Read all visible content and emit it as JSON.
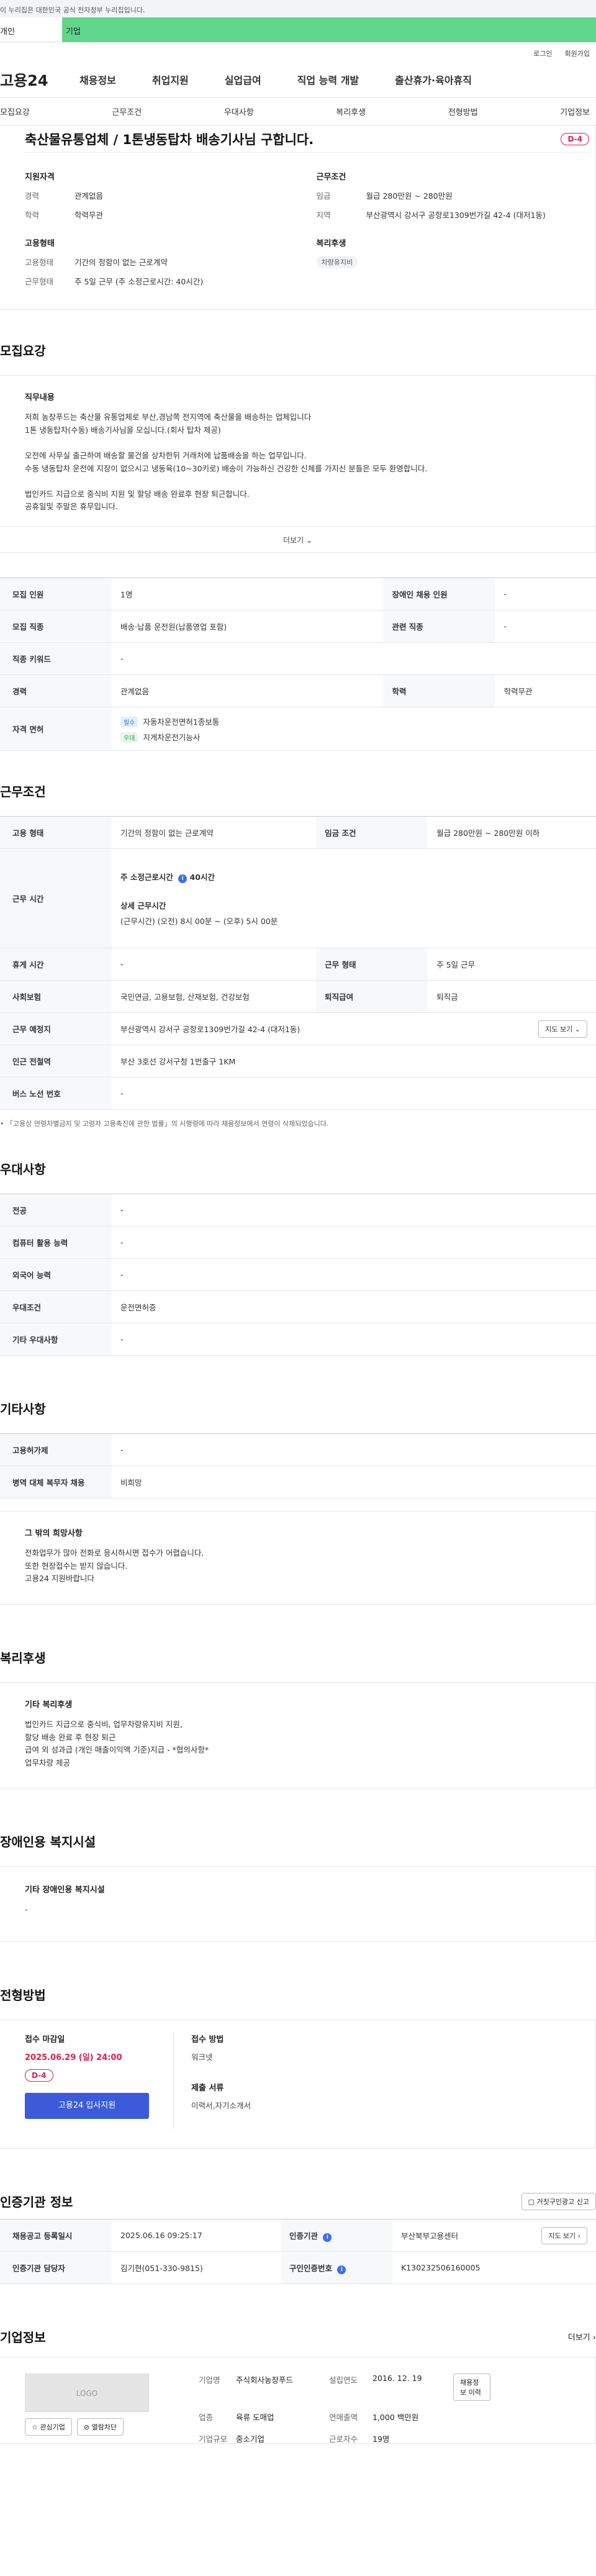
{
  "gov_notice": "이 누리집은 대한민국 공식 전자정부 누리집입니다.",
  "top_tabs": {
    "person": "개인",
    "company": "기업"
  },
  "util_links": [
    "로그인",
    "회원가입"
  ],
  "logo": "고용24",
  "gnb": [
    "채용정보",
    "취업지원",
    "실업급여",
    "직업 능력 개발",
    "출산휴가·육아휴직"
  ],
  "sub_tabs": [
    "모집요강",
    "근무조건",
    "우대사항",
    "복리후생",
    "전형방법",
    "기업정보"
  ],
  "summary": {
    "title": "축산물유통업체 / 1톤냉동탑차 배송기사님 구합니다.",
    "dday": "D-4",
    "qual": {
      "heading": "지원자격",
      "rows": [
        {
          "k": "경력",
          "v": "관계없음"
        },
        {
          "k": "학력",
          "v": "학력무관"
        }
      ]
    },
    "cond": {
      "heading": "근무조건",
      "rows": [
        {
          "k": "임금",
          "v": "월급 280만원 ~ 280만원"
        },
        {
          "k": "지역",
          "v": "부산광역시 강서구 공항로1309번가길 42-4 (대저1동)"
        }
      ]
    },
    "emp": {
      "heading": "고용형태",
      "rows": [
        {
          "k": "고용형태",
          "v": "기간의 정함이 없는 근로계약"
        },
        {
          "k": "근무형태",
          "v": "주 5일 근무 (주 소정근로시간: 40시간)"
        }
      ]
    },
    "welfare": {
      "heading": "복리후생",
      "chip": "차량유지비"
    }
  },
  "recruit": {
    "title": "모집요강",
    "job_heading": "직무내용",
    "job_lines": [
      "저희 농장푸드는 축산물 유통업체로 부산,경남쪽 전지역에 축산물을 배송하는 업체입니다",
      "1톤 냉동탑차(수동) 배송기사님을 모십니다.(회사 탑차 제공)",
      "",
      "오전에 사무실 출근하여 배송할 물건을 상차한뒤 거래처에 납품배송을 하는 업무입니다.",
      "수동 냉동탑차 운전에 지장이 없으시고 냉동육(10~30키로) 배송이 가능하신 건강한 신체를 가지신 분들은 모두 환영합니다.",
      "",
      "법인카드 지급으로 중식비 지원 및 할당 배송 완료후 현장 퇴근합니다.",
      "공휴일및 주말은 휴무입니다."
    ],
    "more": "더보기",
    "rows": [
      {
        "k1": "모집 인원",
        "v1": "1명",
        "k2": "장애인 채용 인원",
        "v2": "-"
      },
      {
        "k1": "모집 직종",
        "v1": "배송·납품 운전원(납품영업 포함)",
        "k2": "관련 직종",
        "v2": "-"
      },
      {
        "k1": "직종 키워드",
        "v1": "-"
      },
      {
        "k1": "경력",
        "v1": "관계없음",
        "k2": "학력",
        "v2": "학력무관"
      }
    ],
    "license_label": "자격 면허",
    "licenses": [
      {
        "tag": "필수",
        "name": "자동차운전면허1종보통"
      },
      {
        "tag": "우대",
        "name": "지게차운전기능사"
      }
    ]
  },
  "work": {
    "title": "근무조건",
    "emp_type": {
      "k1": "고용 형태",
      "v1": "기간의 정함이 없는 근로계약",
      "k2": "임금 조건",
      "v2": "월급 280만원 ~ 280만원 이하"
    },
    "hours_label": "근무 시간",
    "weekly_label": "주 소정근로시간",
    "weekly_value": "40시간",
    "detail_label": "상세 근무시간",
    "detail_value": "(근무시간) (오전) 8시 00분 ~ (오후) 5시 00분",
    "rest": {
      "k1": "휴게 시간",
      "v1": "-",
      "k2": "근무 형태",
      "v2": "주 5일 근무"
    },
    "insurance": {
      "k1": "사회보험",
      "v1": "국민연금, 고용보험, 산재보험, 건강보험",
      "k2": "퇴직급여",
      "v2": "퇴직금"
    },
    "place": {
      "k": "근무 예정지",
      "v": "부산광역시 강서구 공항로1309번가길 42-4 (대저1동)",
      "btn": "지도 보기"
    },
    "station": {
      "k": "인근 전철역",
      "v": "부산 3호선 강서구청 1번출구 1KM"
    },
    "bus": {
      "k": "버스 노선 번호",
      "v": "-"
    },
    "note": "「고용상 연령차별금지 및 고령자 고용촉진에 관한 법률」의 시행령에 따라 채용정보에서 연령이 삭제되었습니다."
  },
  "pref": {
    "title": "우대사항",
    "rows": [
      {
        "k": "전공",
        "v": "-"
      },
      {
        "k": "컴퓨터 활용 능력",
        "v": "-"
      },
      {
        "k": "외국어 능력",
        "v": "-"
      },
      {
        "k": "우대조건",
        "v": "운전면허증"
      },
      {
        "k": "기타 우대사항",
        "v": "-"
      }
    ]
  },
  "etc": {
    "title": "기타사항",
    "rows": [
      {
        "k": "고용허가제",
        "v": "-"
      },
      {
        "k": "병역 대체 복무자 채용",
        "v": "비희망"
      }
    ],
    "wish_heading": "그 밖의 희망사항",
    "wish_lines": [
      "전화업무가 많아 전화로 응시하시면 접수가 어렵습니다.",
      "또한 현장접수는 받지 않습니다.",
      "고용24 지원바랍니다"
    ]
  },
  "welfare": {
    "title": "복리후생",
    "heading": "기타 복리후생",
    "lines": [
      "법인카드 지급으로 중식비, 업무차량유지비 지원,",
      "할당 배송 완료 후 현장 퇴근",
      "급여 외 성과급 (개인 매출이익액 기준)지급 - *협의사항*",
      "업무차량 제공"
    ]
  },
  "disab": {
    "title": "장애인용 복지시설",
    "heading": "기타 장애인용 복지시설",
    "value": "-"
  },
  "apply": {
    "title": "전형방법",
    "deadline_label": "접수 마감일",
    "deadline": "2025.06.29 (일) 24:00",
    "dday": "D-4",
    "button": "고용24 입사지원",
    "method_label": "접수 방법",
    "method": "워크넷",
    "docs_label": "제출 서류",
    "docs": "이력서,자기소개서"
  },
  "agency": {
    "title": "인증기관 정보",
    "report_btn": "거짓구인광고 신고",
    "row1": {
      "k1": "채용공고 등록일시",
      "v1": "2025.06.16 09:25:17",
      "k2": "인증기관",
      "v2": "부산북부고용센터",
      "btn": "지도 보기"
    },
    "row2": {
      "k1": "인증기관 담당자",
      "v1": "김기현(051-330-9815)",
      "k2": "구인인증번호",
      "v2": "K130232506160005"
    }
  },
  "corp": {
    "title": "기업정보",
    "more": "더보기",
    "logo_text": "LOGO",
    "fav_btn": "관심기업",
    "block_btn": "열람차단",
    "fields": [
      {
        "k": "기업명",
        "v": "주식회사농장푸드"
      },
      {
        "k": "설립연도",
        "v": "2016. 12. 19"
      },
      {
        "k": "업종",
        "v": "육류 도매업"
      },
      {
        "k": "연매출액",
        "v": "1,000 백만원"
      },
      {
        "k": "기업규모",
        "v": "중소기업"
      },
      {
        "k": "근로자수",
        "v": "19명"
      }
    ],
    "jobs_btn": "채용정보 이력"
  }
}
